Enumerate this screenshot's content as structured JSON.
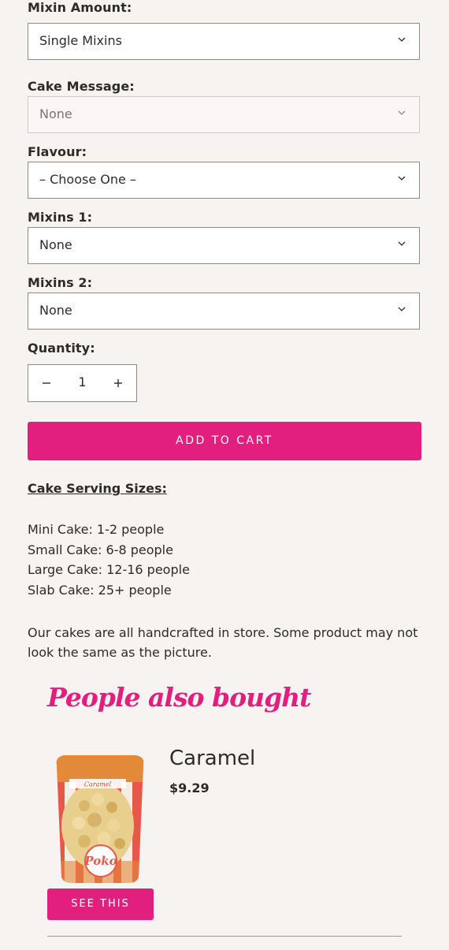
{
  "form": {
    "mixin_amount": {
      "label": "Mixin Amount:",
      "value": "Single Mixins"
    },
    "cake_message": {
      "label": "Cake Message:",
      "value": "None"
    },
    "flavour": {
      "label": "Flavour:",
      "value": "– Choose One –"
    },
    "mixins_1": {
      "label": "Mixins 1:",
      "value": "None"
    },
    "mixins_2": {
      "label": "Mixins 2:",
      "value": "None"
    },
    "quantity": {
      "label": "Quantity:",
      "value": "1",
      "minus": "−",
      "plus": "+"
    },
    "add_to_cart": "ADD TO CART"
  },
  "serving": {
    "heading": "Cake Serving Sizes:",
    "lines": [
      "Mini Cake: 1-2 people",
      "Small Cake: 6-8 people",
      "Large Cake: 12-16 people",
      "Slab Cake: 25+ people"
    ]
  },
  "disclaimer": "Our cakes are all handcrafted in store. Some product may not look the same as the picture.",
  "also_bought": {
    "title": "People also bought",
    "product": {
      "name": "Caramel",
      "price": "$9.29",
      "button": "SEE THIS",
      "bag_label": "Caramel",
      "brand": "Poko"
    }
  },
  "colors": {
    "accent": "#e21f7e",
    "background": "#f7f3f0",
    "text": "#2f2a28"
  },
  "icons": {
    "chevron": "chevron-down-icon",
    "minus": "minus-icon",
    "plus": "plus-icon"
  }
}
